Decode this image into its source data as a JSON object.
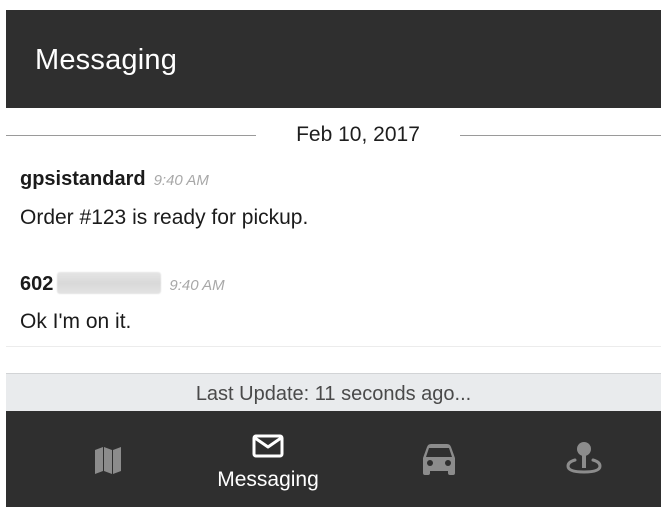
{
  "header": {
    "title": "Messaging"
  },
  "messages": {
    "date_separator": "Feb 10, 2017",
    "items": [
      {
        "sender": "gpsistandard",
        "time": "9:40 AM",
        "text": "Order #123 is ready for pickup."
      },
      {
        "sender": "602",
        "sender_redacted": true,
        "time": "9:40 AM",
        "text": "Ok I'm on it."
      }
    ]
  },
  "status": {
    "text": "Last Update: 11 seconds ago..."
  },
  "nav": {
    "items": [
      {
        "icon": "map-icon",
        "label": ""
      },
      {
        "icon": "envelope-icon",
        "label": "Messaging",
        "active": true
      },
      {
        "icon": "car-icon",
        "label": ""
      },
      {
        "icon": "location-pin-icon",
        "label": ""
      }
    ]
  },
  "colors": {
    "header_bg": "#2f2f2f",
    "nav_bg": "#2f2f2f",
    "status_bg": "#e9ebed",
    "icon_inactive": "#8c8c8c",
    "icon_active": "#ffffff"
  }
}
